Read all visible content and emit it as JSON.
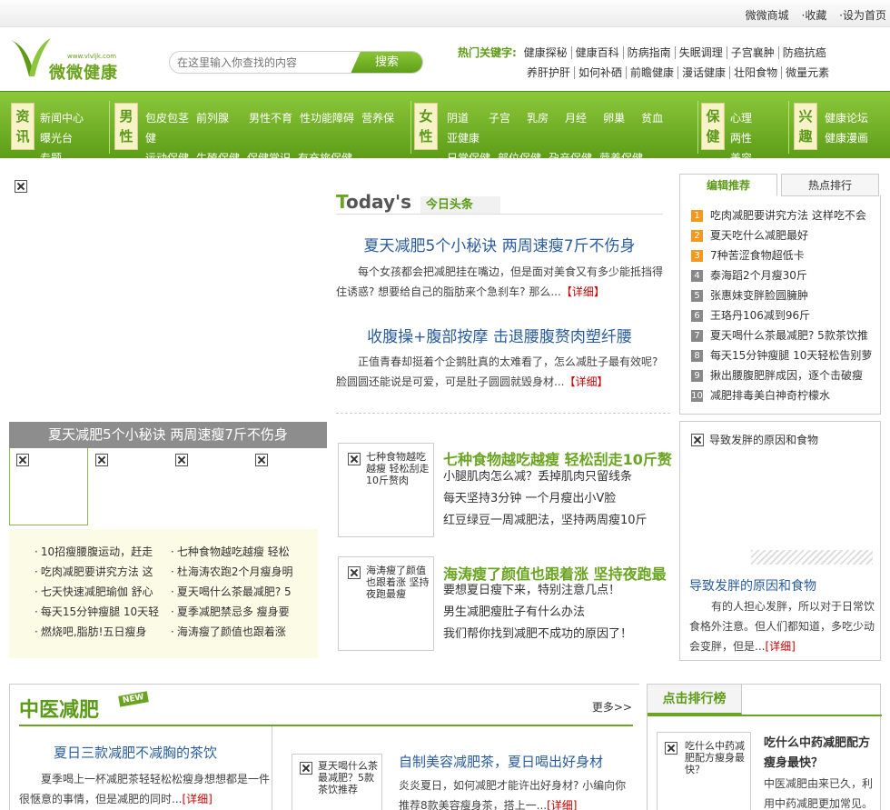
{
  "topbar": {
    "links": [
      "微微商城",
      "·收藏",
      "·设为首页"
    ]
  },
  "logo": {
    "url": "www.vlvljk.com",
    "name": "微微健康"
  },
  "search": {
    "placeholder": "在这里输入你查找的内容",
    "button": "搜索"
  },
  "hot": {
    "label": "热门关键字:",
    "row1": [
      "健康探秘",
      "健康百科",
      "防病指南",
      "失眠调理",
      "子宫襄肿",
      "防癌抗癌"
    ],
    "row2": [
      "养肝护肝",
      "如何补硒",
      "前瞻健康",
      "漫话健康",
      "壮阳食物",
      "微量元素"
    ]
  },
  "nav": {
    "zixun": {
      "tag": "资讯",
      "row1": [
        "新闻中心"
      ],
      "row2": [
        "曝光台",
        "专题"
      ]
    },
    "nanxing": {
      "tag": "男性",
      "row1": [
        "包皮包茎",
        "前列腺",
        "男性不育",
        "性功能障碍",
        "营养保"
      ],
      "row2": [
        "健"
      ],
      "row3": [
        "运动保健",
        "生殖保健",
        "保健常识",
        "有充旅保健"
      ]
    },
    "nvxing": {
      "tag": "女性",
      "row1": [
        "阴道",
        "子宫",
        "乳房",
        "月经",
        "卵巢",
        "贫血"
      ],
      "row2": [
        "亚健康"
      ],
      "row3": [
        "日常保健",
        "部位保健",
        "孕产保健",
        "营养保健"
      ]
    },
    "baojian": {
      "tag": "保健",
      "row1": [
        "心理",
        "两性"
      ],
      "row2": [
        "美容",
        "减肥"
      ]
    },
    "xingqu": {
      "tag": "兴趣",
      "row1": [
        "健康论坛"
      ],
      "row2": [
        "健康漫画"
      ]
    }
  },
  "slide": {
    "title": "夏天减肥5个小秘诀 两周速瘦7斤不伤身"
  },
  "leftlist": {
    "col1": [
      "10招瘦腰腹运动，赶走",
      "吃肉减肥要讲究方法 这",
      "七天快速减肥瑜伽 舒心",
      "每天15分钟瘦腿 10天轻",
      "燃烧吧,脂肪!五日瘦身"
    ],
    "col2": [
      "七种食物越吃越瘦 轻松",
      "杜海涛农跑2个月瘦身明",
      "夏天喝什么茶最减肥? 5",
      "夏季减肥禁忌多 瘦身要",
      "海涛瘦了颜值也跟着涨"
    ]
  },
  "today": {
    "big_t": "T",
    "big_rest": "oday's",
    "sub": "今日头条"
  },
  "headlines": [
    {
      "title": "夏天减肥5个小秘诀 两周速瘦7斤不伤身",
      "summary": "每个女孩都会把减肥挂在嘴边，但是面对美食又有多少能抵挡得住诱惑? 想要给自己的脂肪来个急刹车? 那么...",
      "more": "【详细】"
    },
    {
      "title": "收腹操+腹部按摩 击退腰腹赘肉塑纤腰",
      "summary": "正值青春却挺着个企鹅肚真的太难看了，怎么减肚子最有效呢? 脸圆圆还能说是可爱，可是肚子圆圆就毁身材...",
      "more": "【详细】"
    }
  ],
  "features": [
    {
      "caption": "七种食物越吃越瘦 轻松刮走10斤赘肉",
      "title": "七种食物越吃越瘦 轻松刮走10斤赘",
      "lines": [
        "小腿肌肉怎么减？丢掉肌肉只留线条",
        "每天坚持3分钟 一个月瘦出小V脸",
        "红豆绿豆一周减肥法，坚持两周瘦10斤"
      ]
    },
    {
      "caption": "海涛瘦了颜值也跟着涨 坚持夜跑最瘦",
      "title": "海涛瘦了颜值也跟着涨 坚持夜跑最",
      "lines": [
        "要想夏日瘦下来，特别注意几点！",
        "男生减肥瘦肚子有什么办法",
        "我们帮你找到减肥不成功的原因了！"
      ]
    }
  ],
  "tabs": {
    "active": "编辑推荐",
    "other": "热点排行"
  },
  "ranking": [
    {
      "n": "1",
      "t": "吃肉减肥要讲究方法 这样吃不会"
    },
    {
      "n": "2",
      "t": "夏天吃什么减肥最好"
    },
    {
      "n": "3",
      "t": "7种苦涩食物超低卡"
    },
    {
      "n": "4",
      "t": "泰海蹈2个月瘦30斤"
    },
    {
      "n": "5",
      "t": "张惠妹变胖脸圆臃肿"
    },
    {
      "n": "6",
      "t": "王珞丹106减到96斤"
    },
    {
      "n": "7",
      "t": "夏天喝什么茶最减肥? 5款茶饮推"
    },
    {
      "n": "8",
      "t": "每天15分钟瘦腿 10天轻松告别萝"
    },
    {
      "n": "9",
      "t": "揪出腰腹肥胖成因，逐个击破瘦"
    },
    {
      "n": "10",
      "t": "减肥排毒美白神奇柠檬水"
    }
  ],
  "hair": {
    "caption": "导致发胖的原因和食物",
    "title": "导致发胖的原因和食物",
    "summary": "有的人担心发胖，所以对于日常饮食格外注意。但人们都知道，多吃少动会变胖，但是...",
    "more": "[详细]"
  },
  "tcm": {
    "head": "中医减肥",
    "new": "NEW",
    "more": "更多>>",
    "h1": "夏日三款减肥不减胸的茶饮",
    "s1": "夏季喝上一杯减肥茶轻轻松松瘦身想想都是一件很惬意的事情，但是减肥的同时...",
    "s1more": "[详细]",
    "imgcap": "夏天喝什么茶最减肥？5款茶饮推荐",
    "h2": "自制美容减肥茶，夏日喝出好身材",
    "s2": "炎炎夏日，如何减肥才能许出好身材? 小编向你推荐8款美容瘦身茶，搭上一...",
    "s2more": "[详细]"
  },
  "click": {
    "head": "点击排行榜",
    "imgcap": "吃什么中药减肥配方瘦身最快？",
    "title": "吃什么中药减肥配方瘦身最快？",
    "summary": "中医减肥由来已久，利用中药减肥更加常见。"
  }
}
